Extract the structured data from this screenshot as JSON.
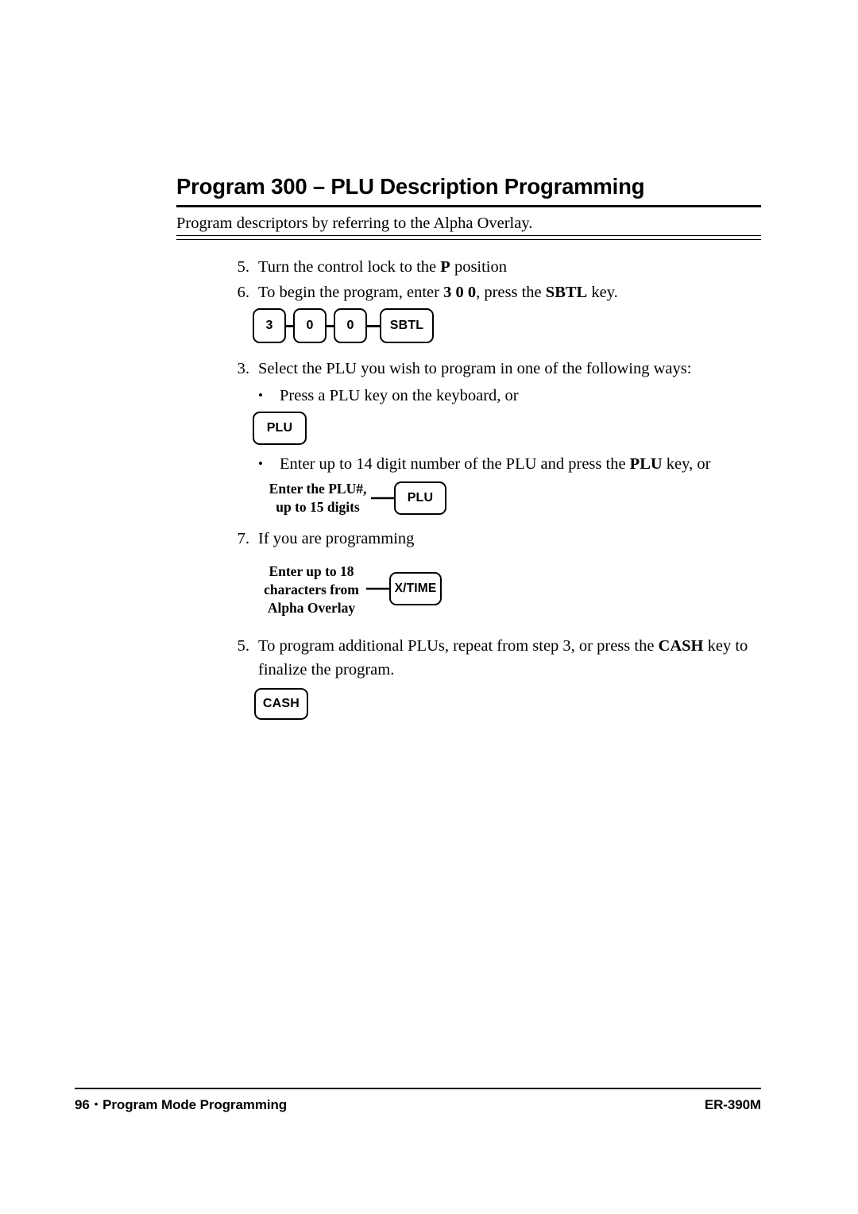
{
  "header": {
    "title": "Program 300 – PLU Description Programming",
    "descriptor": "Program descriptors by referring to the Alpha Overlay."
  },
  "steps": [
    {
      "number": "5.",
      "text_before": "Turn the control lock to the ",
      "bold": "P",
      "text_after": " position"
    },
    {
      "number": "6.",
      "text_before": "To begin the program, enter ",
      "bold": "3 0 0",
      "text_mid": ", press the ",
      "bold2": "SBTL",
      "text_after": " key."
    },
    {
      "number": "3.",
      "text": "Select the PLU you wish to program in one of the following ways:"
    },
    {
      "number": "7.",
      "text": "If you are programming"
    },
    {
      "number": "5.",
      "text_before": "To program additional PLUs, repeat from step 3, or press the ",
      "bold": "CASH",
      "text_after": " key to finalize the program."
    }
  ],
  "bullets": [
    {
      "text": "Press a PLU key on the keyboard, or"
    },
    {
      "text_before": "Enter up to 14 digit number of the PLU and press the ",
      "bold": "PLU",
      "text_after": " key, or"
    }
  ],
  "key_sequence": {
    "keys": [
      "3",
      "0",
      "0",
      "SBTL"
    ]
  },
  "figures": {
    "plu_key_alone": {
      "label": "PLU"
    },
    "plu_number_entry": {
      "caption": "Enter the PLU#,\nup to 15 digits",
      "key": "PLU"
    },
    "alpha_overlay_entry": {
      "caption": "Enter up to 18\ncharacters from\nAlpha Overlay",
      "key": "X/TIME"
    },
    "cash_key": {
      "label": "CASH"
    }
  },
  "footer": {
    "page_number": "96",
    "separator": "•",
    "section": "Program Mode Programming",
    "model": "ER-390M"
  }
}
